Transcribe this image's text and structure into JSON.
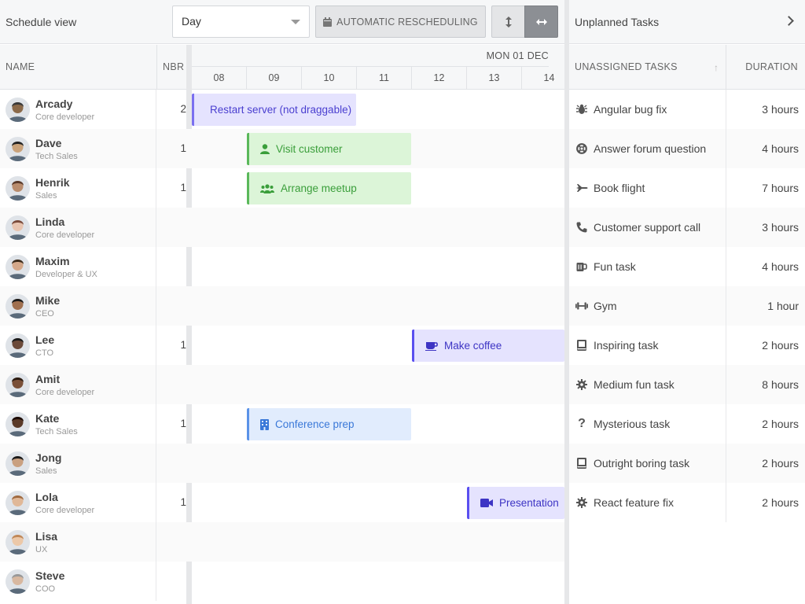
{
  "toolbar": {
    "title": "Schedule view",
    "view_select": "Day",
    "auto_reschedule_label": "AUTOMATIC RESCHEDULING"
  },
  "grid_header": {
    "name": "NAME",
    "nbr": "NBR TASKS"
  },
  "timeline": {
    "day": "MON 01 DEC",
    "hours": [
      "08",
      "09",
      "10",
      "11",
      "12",
      "13",
      "14"
    ]
  },
  "resources": [
    {
      "name": "Arcady",
      "role": "Core developer",
      "nbr": "2"
    },
    {
      "name": "Dave",
      "role": "Tech Sales",
      "nbr": "1"
    },
    {
      "name": "Henrik",
      "role": "Sales",
      "nbr": "1"
    },
    {
      "name": "Linda",
      "role": "Core developer",
      "nbr": ""
    },
    {
      "name": "Maxim",
      "role": "Developer & UX",
      "nbr": ""
    },
    {
      "name": "Mike",
      "role": "CEO",
      "nbr": ""
    },
    {
      "name": "Lee",
      "role": "CTO",
      "nbr": "1"
    },
    {
      "name": "Amit",
      "role": "Core developer",
      "nbr": ""
    },
    {
      "name": "Kate",
      "role": "Tech Sales",
      "nbr": "1"
    },
    {
      "name": "Jong",
      "role": "Sales",
      "nbr": ""
    },
    {
      "name": "Lola",
      "role": "Core developer",
      "nbr": "1"
    },
    {
      "name": "Lisa",
      "role": "UX",
      "nbr": ""
    },
    {
      "name": "Steve",
      "role": "COO",
      "nbr": ""
    }
  ],
  "events": [
    {
      "row": 0,
      "start": 8,
      "end": 11,
      "name": "Restart server (not draggable)",
      "icon": "",
      "style": "purple"
    },
    {
      "row": 1,
      "start": 9,
      "end": 12,
      "name": "Visit customer",
      "icon": "user-icon",
      "style": "green"
    },
    {
      "row": 2,
      "start": 9,
      "end": 12,
      "name": "Arrange meetup",
      "icon": "users-icon",
      "style": "green"
    },
    {
      "row": 6,
      "start": 12,
      "end": 15,
      "name": "Make coffee",
      "icon": "coffee-icon",
      "style": "purple2"
    },
    {
      "row": 8,
      "start": 9,
      "end": 12,
      "name": "Conference prep",
      "icon": "building-icon",
      "style": "blue"
    },
    {
      "row": 10,
      "start": 13,
      "end": 16,
      "name": "Presentation",
      "icon": "video-icon",
      "style": "purple2"
    }
  ],
  "unplanned": {
    "title": "Unplanned Tasks",
    "col_task": "UNASSIGNED TASKS",
    "col_duration": "DURATION",
    "tasks": [
      {
        "name": "Angular bug fix",
        "duration": "3 hours",
        "icon": "bug-icon"
      },
      {
        "name": "Answer forum question",
        "duration": "4 hours",
        "icon": "lifering-icon"
      },
      {
        "name": "Book flight",
        "duration": "7 hours",
        "icon": "plane-icon"
      },
      {
        "name": "Customer support call",
        "duration": "3 hours",
        "icon": "phone-icon"
      },
      {
        "name": "Fun task",
        "duration": "4 hours",
        "icon": "mug-icon"
      },
      {
        "name": "Gym",
        "duration": "1 hour",
        "icon": "dumbbell-icon"
      },
      {
        "name": "Inspiring task",
        "duration": "2 hours",
        "icon": "book-icon"
      },
      {
        "name": "Medium fun task",
        "duration": "8 hours",
        "icon": "cog-icon"
      },
      {
        "name": "Mysterious task",
        "duration": "2 hours",
        "icon": "question-icon"
      },
      {
        "name": "Outright boring task",
        "duration": "2 hours",
        "icon": "book-icon"
      },
      {
        "name": "React feature fix",
        "duration": "2 hours",
        "icon": "cog-icon"
      }
    ]
  }
}
